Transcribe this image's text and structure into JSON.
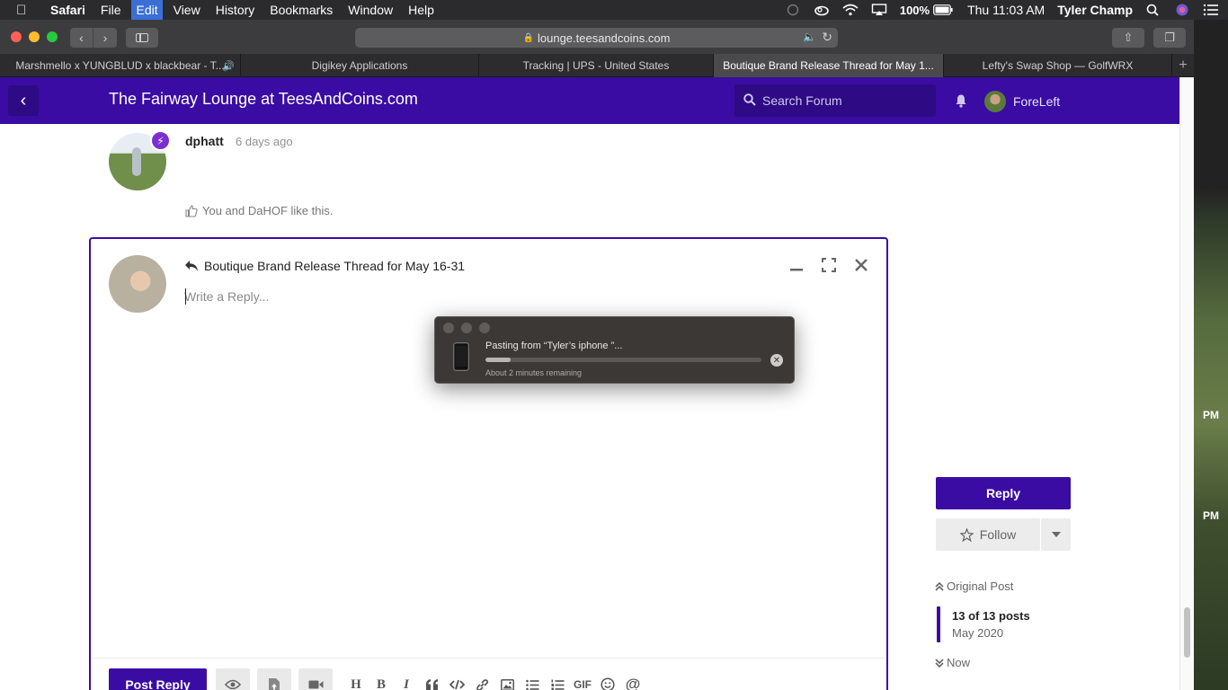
{
  "menubar": {
    "app": "Safari",
    "items": [
      "File",
      "Edit",
      "View",
      "History",
      "Bookmarks",
      "Window",
      "Help"
    ],
    "battery": "100%",
    "clock": "Thu 11:03 AM",
    "user": "Tyler Champ"
  },
  "browser": {
    "url": "lounge.teesandcoins.com",
    "tabs": [
      {
        "label": "Marshmello x YUNGBLUD x blackbear - T..."
      },
      {
        "label": "Digikey Applications"
      },
      {
        "label": "Tracking | UPS - United States"
      },
      {
        "label": "Boutique Brand Release Thread for May 1..."
      },
      {
        "label": "Lefty's Swap Shop — GolfWRX"
      }
    ]
  },
  "forum": {
    "title": "The Fairway Lounge at TeesAndCoins.com",
    "search_placeholder": "Search Forum",
    "username": "ForeLeft",
    "brand_color": "#3a0ca3"
  },
  "post": {
    "author": "dphatt",
    "time": "6 days ago",
    "likes": "You and DaHOF like this."
  },
  "composer": {
    "title": "Boutique Brand Release Thread for May 16-31",
    "placeholder": "Write a Reply...",
    "submit_label": "Post Reply",
    "gif_label": "GIF"
  },
  "paste_dialog": {
    "message": "Pasting from “Tyler’s iphone ”...",
    "remaining": "About 2 minutes remaining",
    "progress": 0.09
  },
  "sidebar": {
    "reply_label": "Reply",
    "follow_label": "Follow",
    "original_post": "Original Post",
    "count": "13 of 13 posts",
    "date": "May 2020",
    "now": "Now"
  },
  "desktop": {
    "time_label_1": "PM",
    "time_label_2": "PM"
  }
}
